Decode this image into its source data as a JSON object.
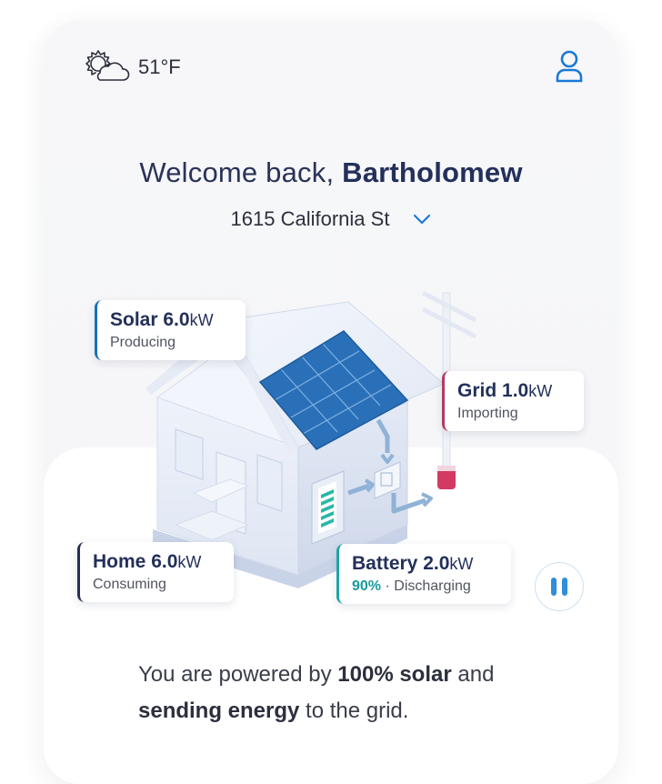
{
  "weather": {
    "icon": "partly-cloudy-icon",
    "temperature": "51°F"
  },
  "header": {
    "user_icon": "user-icon"
  },
  "welcome": {
    "prefix": "Welcome back,",
    "name": "Bartholomew"
  },
  "address": {
    "text": "1615 California St",
    "icon": "chevron-down-icon"
  },
  "energy": {
    "solar": {
      "label": "Solar",
      "value": "6.0",
      "unit": "kW",
      "status": "Producing"
    },
    "grid": {
      "label": "Grid",
      "value": "1.0",
      "unit": "kW",
      "status": "Importing"
    },
    "home": {
      "label": "Home",
      "value": "6.0",
      "unit": "kW",
      "status": "Consuming"
    },
    "battery": {
      "label": "Battery",
      "value": "2.0",
      "unit": "kW",
      "percent": "90%",
      "separator": "·",
      "status": "Discharging"
    }
  },
  "status_message": {
    "part1": "You are powered by ",
    "bold1": "100% solar",
    "part2": " and",
    "bold2": "sending energy",
    "part3": " to the grid."
  },
  "colors": {
    "accent": "#1a6fb5",
    "solar": "#1a6fb5",
    "grid": "#b23b62",
    "battery": "#1ea4a6",
    "text_dark": "#23305a"
  }
}
